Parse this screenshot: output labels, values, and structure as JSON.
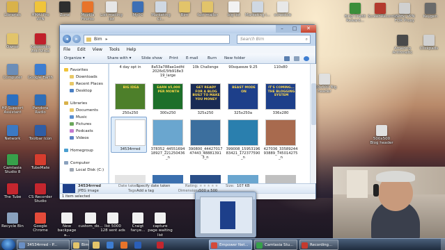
{
  "desktop_icons": [
    {
      "label": "Libraries",
      "color": "#d9b24a"
    },
    {
      "label": "HMA! Pro VPN",
      "color": "#f0c43a"
    },
    {
      "label": "Zune",
      "color": "#2e2e2e"
    },
    {
      "label": "Mozilla Firefox",
      "color": "#e8742a"
    },
    {
      "label": "List mailing list",
      "color": "#e6e6e6"
    },
    {
      "label": "MyPC",
      "color": "#3d6fb5"
    },
    {
      "label": "Marketing Cl...",
      "color": "#cfd8e3"
    },
    {
      "label": "Bim",
      "color": "#e2c46a"
    },
    {
      "label": "fast mailer",
      "color": "#e2c46a"
    },
    {
      "label": "big list",
      "color": "#f2f2f2"
    },
    {
      "label": "Marketing i...",
      "color": "#cfd8e3"
    },
    {
      "label": "schedule",
      "color": "#e8e8e8"
    },
    {
      "label": "Owner",
      "color": "#e2c46a"
    },
    {
      "label": "Kaspersky Anti-Virus",
      "color": "#c0202a"
    },
    {
      "label": "Computer",
      "color": "#6b8db8"
    },
    {
      "label": "Google Earth",
      "color": "#3d7dd1"
    },
    {
      "label": "HP Support Assistant",
      "color": "#2b6fc1"
    },
    {
      "label": "Pandora Radio",
      "color": "#2f6eb8"
    },
    {
      "label": "Network",
      "color": "#3b79c3"
    },
    {
      "label": "Toolbar Icon",
      "color": "#2f5da5"
    },
    {
      "label": "Camtasia Studio 8",
      "color": "#37a04a"
    },
    {
      "label": "TubeMate",
      "color": "#d63d2e"
    },
    {
      "label": "The Tube",
      "color": "#c4262e"
    },
    {
      "label": "CS Recorder Studio",
      "color": "#c4262e"
    },
    {
      "label": "Recycle Bin",
      "color": "#8aa1bd"
    },
    {
      "label": "Google Chrome",
      "color": "#e44b3a"
    },
    {
      "label": "New backpage a...",
      "color": "#f0f0f0"
    },
    {
      "label": "custom_do...",
      "color": "#f0f0f0"
    },
    {
      "label": "list 5000 128 sent ads",
      "color": "#f0f0f0"
    },
    {
      "label": "Craigt fanye...",
      "color": "#f0f0f0"
    },
    {
      "label": "capture page waiting list",
      "color": "#f0f0f0"
    }
  ],
  "right_icons": [
    {
      "label": "Bing Credit Reward...",
      "color": "#3b8e3b"
    },
    {
      "label": "ScreenRecorder",
      "color": "#b33a2e"
    },
    {
      "label": "(SMS) VPN FOR Proxy",
      "color": "#d0d0d0"
    },
    {
      "label": "Keygen",
      "color": "#6a6a6a"
    },
    {
      "label": "Amazing Arithmetic",
      "color": "#4a4a4a"
    },
    {
      "label": "Clickpads",
      "color": "#d0d0d0"
    },
    {
      "label": "500x500 Big header",
      "color": "#e0e0e0"
    },
    {
      "label": "500x500 Blog header",
      "color": "#e0e0e0"
    }
  ],
  "explorer": {
    "breadcrumb": "Bim",
    "search_placeholder": "Search Bim",
    "menu": [
      "File",
      "Edit",
      "View",
      "Tools",
      "Help"
    ],
    "commands": [
      "Organize ▾",
      "Share with ▾",
      "Slide show",
      "Print",
      "E-mail",
      "Burn",
      "New folder"
    ],
    "nav": {
      "favorites": "Favorites",
      "favorites_items": [
        "Downloads",
        "Recent Places",
        "Desktop"
      ],
      "libraries": "Libraries",
      "libraries_items": [
        "Documents",
        "Music",
        "Pictures",
        "Podcasts",
        "Videos"
      ],
      "homegroup": "Homegroup",
      "computer": "Computer",
      "local_disk": "Local Disk (C:)"
    },
    "top_row_captions": [
      "4 day opt in",
      "8a53a788ae1edfd\n2026d15fb918e3\n19_large",
      "10k Challenge",
      "90squeeze 9.25",
      "110x80"
    ],
    "row1": [
      {
        "caption": "250x250",
        "color": "#4d7f2a",
        "text": "BIG IDEA"
      },
      {
        "caption": "300x250",
        "color": "#1d6f2a",
        "text": "EARN $5,000 PER MONTH"
      },
      {
        "caption": "325x250",
        "color": "#1a2b55",
        "text": "GET READY FOR A BLOG BUILT TO MAKE YOU MONEY"
      },
      {
        "caption": "325x250a",
        "color": "#1d3f8a",
        "text": "BEAST MODE ON"
      },
      {
        "caption": "336x280",
        "color": "#1d3f8a",
        "text": "IT'S COMING... THE BLOGGING SYSTEM"
      }
    ],
    "row2": [
      {
        "caption": "34534rrred",
        "color": "#ffffff"
      },
      {
        "caption": "378352_44551694\n18927_221250436\n_n",
        "color": "#6aa6cf"
      },
      {
        "caption": "390800_44427017\n47443_48881391\n3_n",
        "color": "#3c6f9e"
      },
      {
        "caption": "399008_15953196\n83421_172377590\n_n",
        "color": "#2a7fae"
      },
      {
        "caption": "427036_33589244\n93889_745014275\n_n",
        "color": "#a86a4e"
      }
    ],
    "details": {
      "name": "34534rrred",
      "type": "JPEG image",
      "date_label": "Date taken:",
      "date_value": "Specify date taken",
      "tags_label": "Tags:",
      "tags_value": "Add a tag",
      "rating_label": "Rating:",
      "dims_label": "Dimensions:",
      "dims_value": "500 x 500",
      "size_label": "Size:",
      "size_value": "107 KB"
    },
    "status": "1 item selected"
  },
  "taskbar": {
    "items": [
      {
        "label": "34534rrred - P...",
        "color": "#6a8fc4"
      },
      {
        "label": "Bim",
        "color": "#e2c46a"
      },
      {
        "label": "Empower Net...",
        "color": "#d44a3a"
      },
      {
        "label": "Camtasia Stu...",
        "color": "#37a04a"
      },
      {
        "label": "Recording...",
        "color": "#c43a2e"
      }
    ],
    "pins": [
      {
        "name": "windows-explorer-pin",
        "color": "#e2c46a"
      },
      {
        "name": "ie-pin",
        "color": "#3d7dd1"
      },
      {
        "name": "media-player-pin",
        "color": "#e8742a"
      },
      {
        "name": "word-pin",
        "color": "#2b5fb8"
      },
      {
        "name": "acrobat-pin",
        "color": "#c4262e"
      }
    ]
  }
}
